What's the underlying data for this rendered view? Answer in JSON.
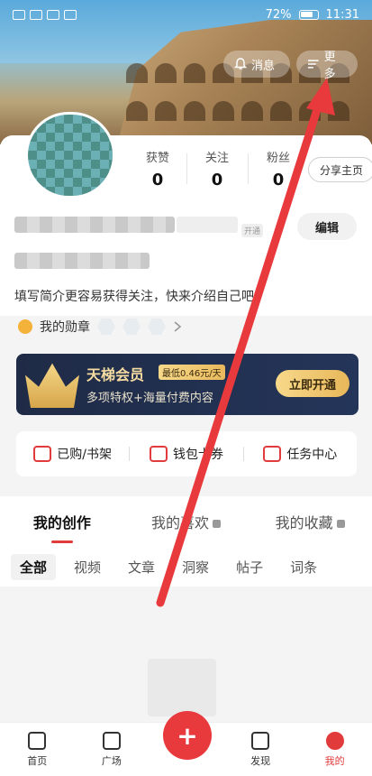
{
  "statusbar": {
    "time": "11:31",
    "battery": "72%"
  },
  "header": {
    "messages_label": "消息",
    "more_label": "更多"
  },
  "profile": {
    "stats": [
      {
        "label": "获赞",
        "value": "0"
      },
      {
        "label": "关注",
        "value": "0"
      },
      {
        "label": "粉丝",
        "value": "0"
      }
    ],
    "share_label": "分享主页",
    "edit_label": "编辑",
    "vip_tag": "开通",
    "bio": "填写简介更容易获得关注，快来介绍自己吧",
    "medal_label": "我的勋章"
  },
  "vip": {
    "title": "天梯会员",
    "price_badge": "最低0.46元/天",
    "subtitle": "多项特权+海量付费内容",
    "cta": "立即开通"
  },
  "quick": [
    {
      "label": "已购/书架",
      "icon": "cart-icon"
    },
    {
      "label": "钱包卡券",
      "icon": "wallet-icon"
    },
    {
      "label": "任务中心",
      "icon": "task-icon"
    }
  ],
  "tabs": [
    {
      "label": "我的创作"
    },
    {
      "label": "我的喜欢"
    },
    {
      "label": "我的收藏"
    }
  ],
  "subtabs": [
    "全部",
    "视频",
    "文章",
    "洞察",
    "帖子",
    "词条"
  ],
  "bottomnav": [
    {
      "label": "首页"
    },
    {
      "label": "广场"
    },
    {
      "label": "发现"
    },
    {
      "label": "我的"
    }
  ],
  "fab_label": "+"
}
